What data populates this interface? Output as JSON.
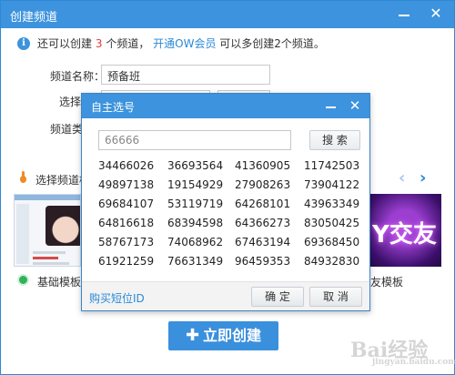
{
  "window": {
    "title": "创建频道"
  },
  "notice": {
    "prefix": "还可以创建",
    "count": "3",
    "middle": "个频道，",
    "link": "开通OW会员",
    "suffix": "可以多创建2个频道。"
  },
  "form": {
    "name_label": "频道名称：",
    "name_value": "预备班",
    "select_label": "选择",
    "type_label": "频道类"
  },
  "templates": {
    "section_label": "选择频道模",
    "items": [
      {
        "label": "基础模板"
      },
      {
        "label": "友模板"
      }
    ],
    "banner_text": "Y交友"
  },
  "create_button": {
    "label": "立即创建"
  },
  "dialog": {
    "title": "自主选号",
    "search_value": "66666",
    "search_button": "搜 索",
    "ids": [
      [
        "34466026",
        "36693564",
        "41360905",
        "11742503"
      ],
      [
        "49897138",
        "19154929",
        "27908263",
        "73904122"
      ],
      [
        "69684107",
        "53119719",
        "64268101",
        "43963349"
      ],
      [
        "64816618",
        "68394598",
        "64366273",
        "83050425"
      ],
      [
        "58767173",
        "74068962",
        "67463194",
        "69368450"
      ],
      [
        "61921259",
        "76631349",
        "96459353",
        "84932830"
      ]
    ],
    "buy_link": "购买短位ID",
    "ok_button": "确 定",
    "cancel_button": "取 消"
  },
  "watermark": {
    "text": "Bai",
    "text2": "经验",
    "sub": "jingyan.baidu.com"
  },
  "colors": {
    "accent": "#3d93dd",
    "link": "#2b8ad6",
    "red": "#e23b3b"
  }
}
